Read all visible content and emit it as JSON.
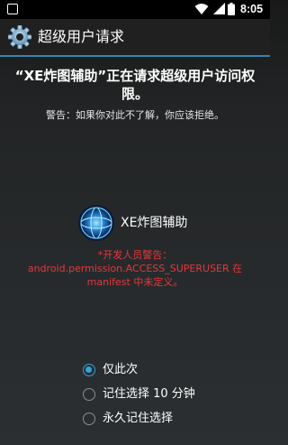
{
  "status_bar": {
    "time": "8:05",
    "icons": [
      "app-notification-icon",
      "wifi-icon",
      "signal-icon",
      "battery-icon"
    ]
  },
  "app_bar": {
    "title": "超级用户请求",
    "icon": "gear-icon"
  },
  "request": {
    "headline_line1": "“XE炸图辅助”正在请求超级用户访问权",
    "headline_line2": "限。",
    "warning": "警告：如果你对此不了解，你应该拒绝。"
  },
  "app": {
    "name": "XE炸图辅助",
    "icon": "app-globe-icon"
  },
  "developer_warning": {
    "line1": "*开发人员警告：",
    "line2": "android.permission.ACCESS_SUPERUSER 在",
    "line3": "manifest 中未定义。"
  },
  "options": [
    {
      "label": "仅此次",
      "selected": true
    },
    {
      "label": "记住选择 10 分钟",
      "selected": false
    },
    {
      "label": "永久记住选择",
      "selected": false
    }
  ],
  "colors": {
    "accent": "#35a4d8",
    "divider": "#2f87b0",
    "warning_text": "#e3383c",
    "app_bar_bg": "#202020"
  }
}
